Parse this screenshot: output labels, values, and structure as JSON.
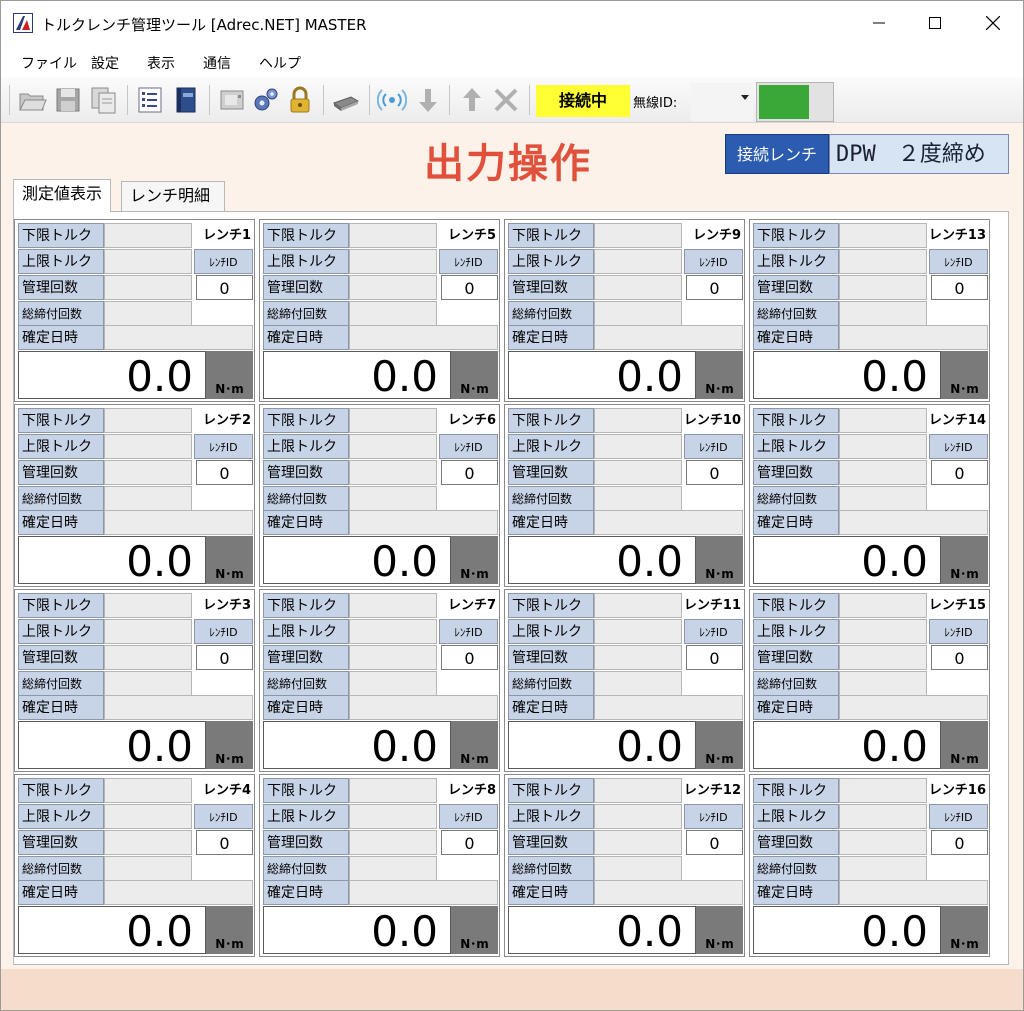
{
  "window": {
    "title": "トルクレンチ管理ツール [Adrec.NET] MASTER"
  },
  "menu": [
    "ファイル",
    "設定",
    "表示",
    "通信",
    "ヘルプ"
  ],
  "toolbar": {
    "status": "接続中",
    "wireless_label": "無線ID:",
    "wireless_value": "",
    "status_color": "#ffff33",
    "toggle_color": "#3aa838"
  },
  "page": {
    "title": "出力操作",
    "title_color": "#e0503a",
    "connected_label": "接続レンチ",
    "connected_value": "DPW　２度締め"
  },
  "tabs": [
    "測定値表示",
    "レンチ明細"
  ],
  "card_labels": {
    "lower": "下限トルク",
    "upper": "上限トルク",
    "manage_count": "管理回数",
    "total_count": "総締付回数",
    "confirm_datetime": "確定日時",
    "wrench_id": "ﾚﾝﾁID",
    "unit": "N･m"
  },
  "wrenches": [
    {
      "name": "レンチ1",
      "count": "0",
      "reading": "0.0"
    },
    {
      "name": "レンチ2",
      "count": "0",
      "reading": "0.0"
    },
    {
      "name": "レンチ3",
      "count": "0",
      "reading": "0.0"
    },
    {
      "name": "レンチ4",
      "count": "0",
      "reading": "0.0"
    },
    {
      "name": "レンチ5",
      "count": "0",
      "reading": "0.0"
    },
    {
      "name": "レンチ6",
      "count": "0",
      "reading": "0.0"
    },
    {
      "name": "レンチ7",
      "count": "0",
      "reading": "0.0"
    },
    {
      "name": "レンチ8",
      "count": "0",
      "reading": "0.0"
    },
    {
      "name": "レンチ9",
      "count": "0",
      "reading": "0.0"
    },
    {
      "name": "レンチ10",
      "count": "0",
      "reading": "0.0"
    },
    {
      "name": "レンチ11",
      "count": "0",
      "reading": "0.0"
    },
    {
      "name": "レンチ12",
      "count": "0",
      "reading": "0.0"
    },
    {
      "name": "レンチ13",
      "count": "0",
      "reading": "0.0"
    },
    {
      "name": "レンチ14",
      "count": "0",
      "reading": "0.0"
    },
    {
      "name": "レンチ15",
      "count": "0",
      "reading": "0.0"
    },
    {
      "name": "レンチ16",
      "count": "0",
      "reading": "0.0"
    }
  ],
  "icons": [
    "folder-open-icon",
    "save-icon",
    "copy-icon",
    "checklist-icon",
    "book-icon",
    "device-icon",
    "gears-icon",
    "lock-icon",
    "scanner-icon",
    "wireless-icon",
    "download-arrow-icon",
    "upload-arrow-icon",
    "delete-x-icon"
  ]
}
